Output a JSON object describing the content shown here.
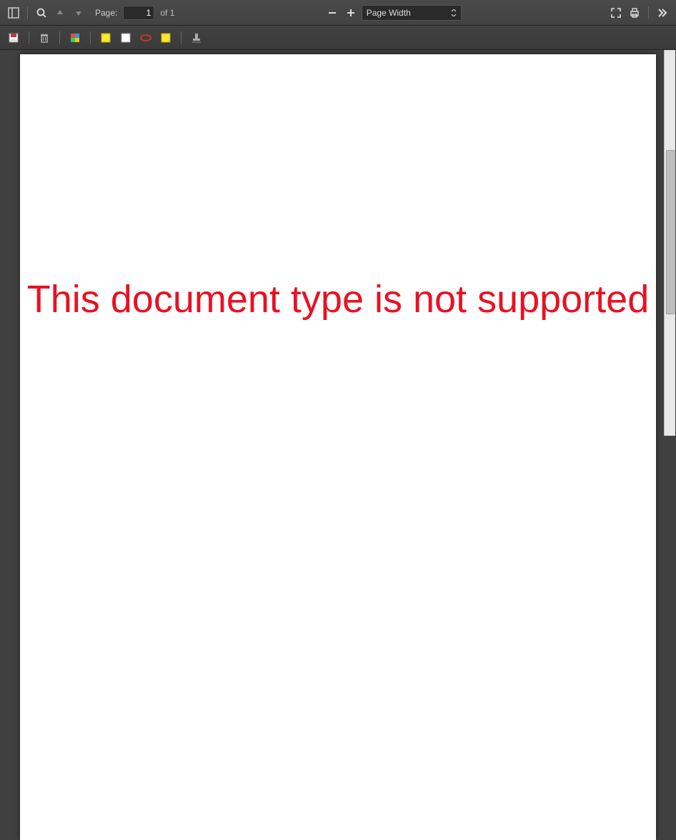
{
  "toolbar": {
    "page_label": "Page:",
    "page_input": "1",
    "of_label": "of",
    "page_total": "1",
    "zoom_select": "Page Width"
  },
  "document": {
    "message": "This document type is not supported"
  }
}
